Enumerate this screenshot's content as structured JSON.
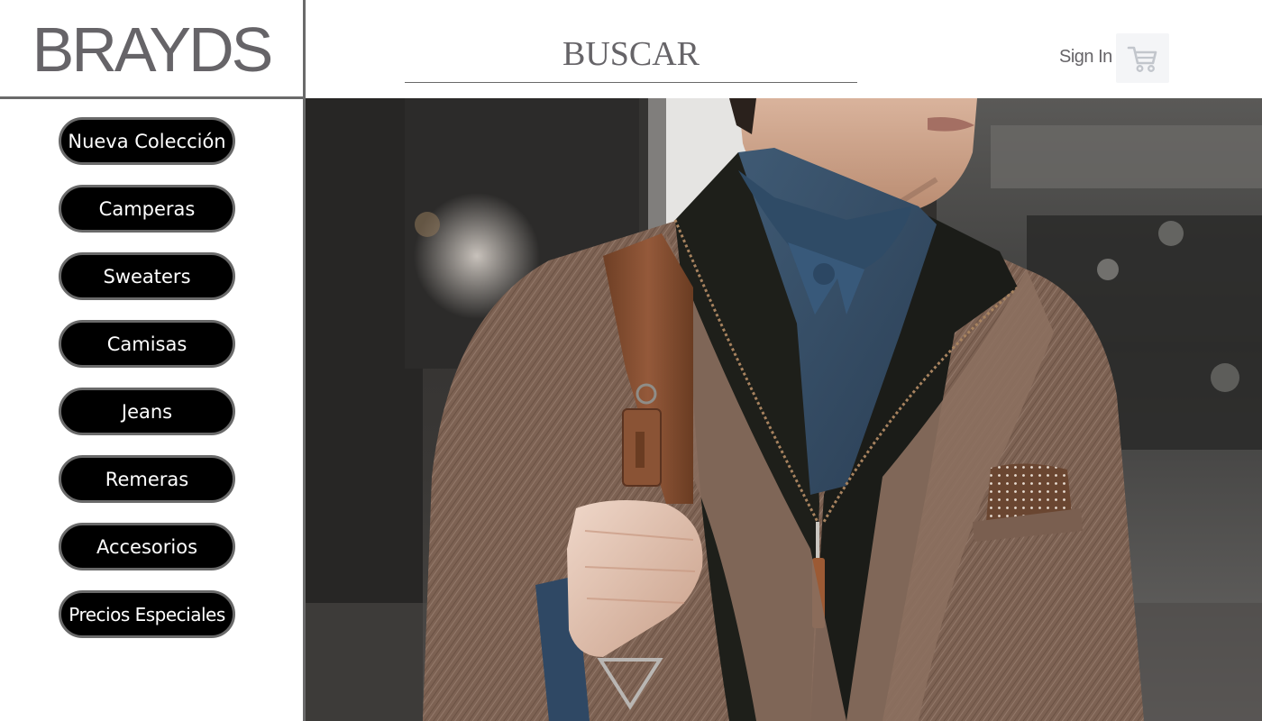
{
  "brand": {
    "logo_text": "BRAYDS"
  },
  "sidebar": {
    "items": [
      {
        "label": "Nueva Colección"
      },
      {
        "label": "Camperas"
      },
      {
        "label": "Sweaters"
      },
      {
        "label": "Camisas"
      },
      {
        "label": "Jeans"
      },
      {
        "label": "Remeras"
      },
      {
        "label": "Accesorios"
      },
      {
        "label": "Precios Especiales"
      }
    ]
  },
  "header": {
    "search_placeholder": "BUSCAR",
    "signin_label": "Sign In",
    "cart_icon": "shopping-cart-icon"
  },
  "hero": {
    "image_subject": "man in brown herringbone blazer with leather bag strap",
    "scroll_icon": "triangle-down-icon"
  },
  "colors": {
    "nav_bg": "#000000",
    "nav_border": "#6a6a6a",
    "text_gray": "#666468",
    "cart_bg": "#f4f5f7"
  }
}
